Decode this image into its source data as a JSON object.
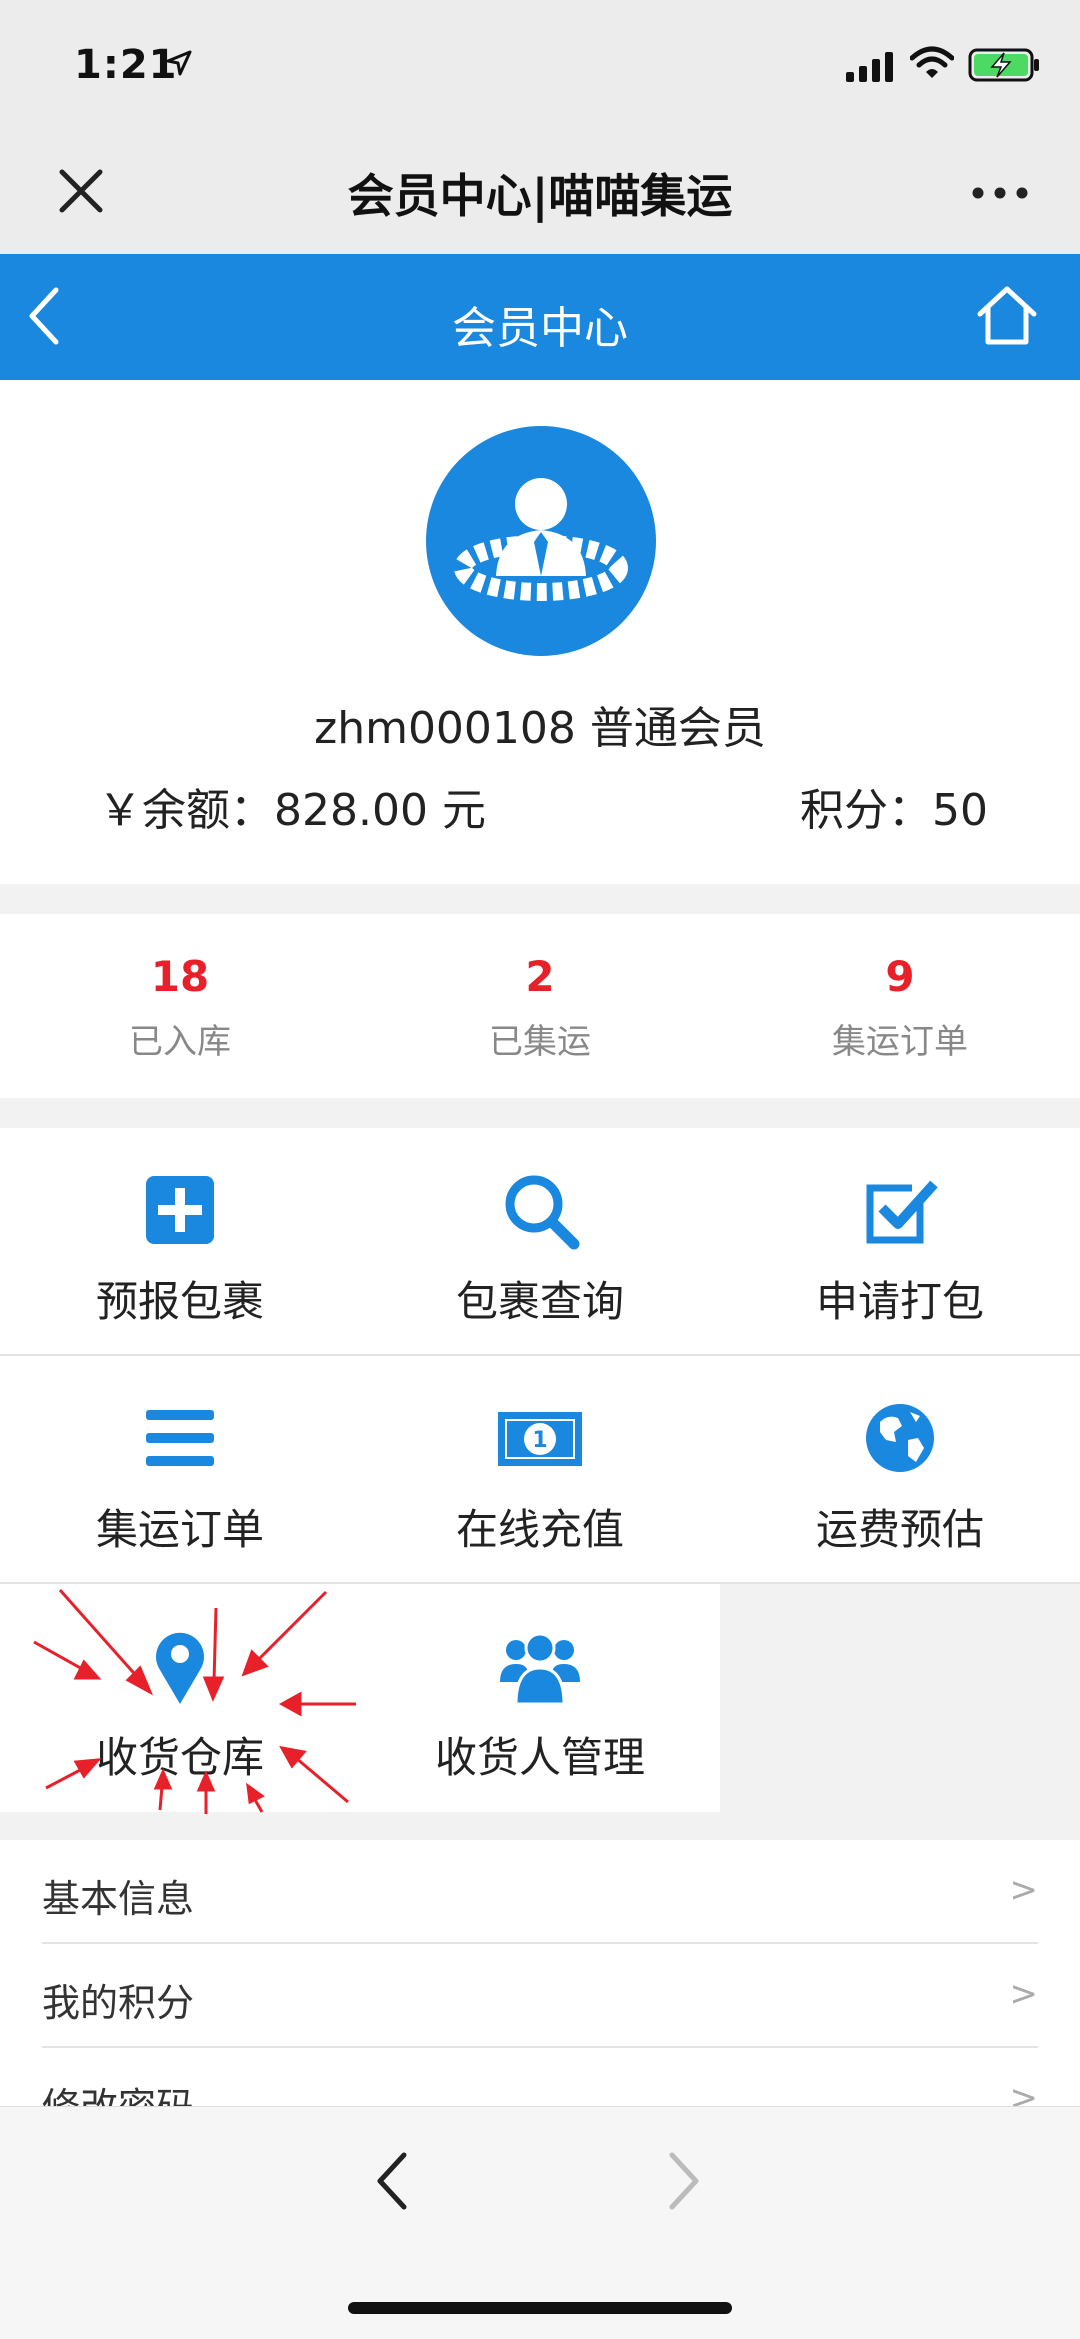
{
  "status_bar": {
    "time": "1:21"
  },
  "wechat_bar": {
    "title": "会员中心|喵喵集运"
  },
  "nav": {
    "title": "会员中心"
  },
  "profile": {
    "username": "zhm000108 普通会员",
    "balance": "￥余额：828.00 元",
    "points": "积分：50"
  },
  "stats": [
    {
      "value": "18",
      "label": "已入库"
    },
    {
      "value": "2",
      "label": "已集运"
    },
    {
      "value": "9",
      "label": "集运订单"
    }
  ],
  "menu": [
    {
      "label": "预报包裹",
      "icon": "plus-square-icon"
    },
    {
      "label": "包裹查询",
      "icon": "search-icon"
    },
    {
      "label": "申请打包",
      "icon": "checkbox-icon"
    },
    {
      "label": "集运订单",
      "icon": "list-icon"
    },
    {
      "label": "在线充值",
      "icon": "money-icon"
    },
    {
      "label": "运费预估",
      "icon": "globe-icon"
    },
    {
      "label": "收货仓库",
      "icon": "location-pin-icon"
    },
    {
      "label": "收货人管理",
      "icon": "users-icon"
    }
  ],
  "list": [
    {
      "label": "基本信息",
      "chevron": ">"
    },
    {
      "label": "我的积分",
      "chevron": ">"
    },
    {
      "label": "修改密码",
      "chevron": ">"
    }
  ],
  "colors": {
    "brand_blue": "#1a88df",
    "stat_red": "#e8202a",
    "annotation_red": "#e8202a"
  }
}
